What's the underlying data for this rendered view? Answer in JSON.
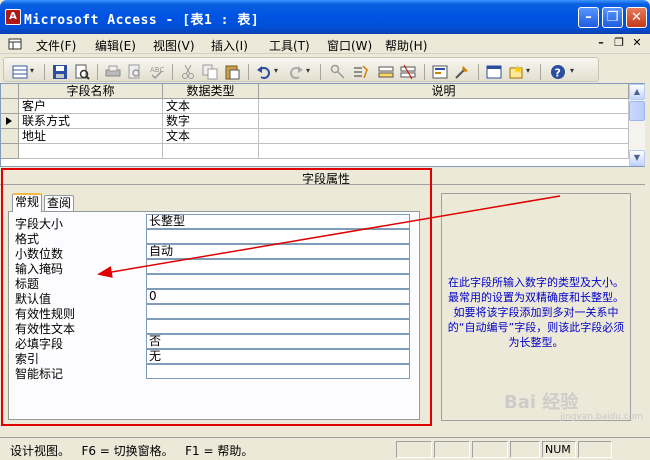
{
  "window": {
    "title": "Microsoft Access - [表1 : 表]",
    "app_icon_letter": "A",
    "buttons": {
      "minimize": "–",
      "restore": "❐",
      "close": "✕"
    }
  },
  "menu": {
    "items": [
      "文件(F)",
      "编辑(E)",
      "视图(V)",
      "插入(I)",
      "工具(T)",
      "窗口(W)",
      "帮助(H)"
    ],
    "mdi_minimize": "–",
    "mdi_restore": "❐",
    "mdi_close": "✕"
  },
  "toolbar": {
    "icons": [
      "design-view-icon",
      "save-icon",
      "search-icon",
      "print-icon",
      "print-preview-icon",
      "spelling-icon",
      "cut-icon",
      "copy-icon",
      "paste-icon",
      "undo-icon",
      "redo-icon",
      "primary-key-icon",
      "indexes-icon",
      "insert-rows-icon",
      "delete-rows-icon",
      "properties-icon",
      "build-icon",
      "database-window-icon",
      "new-object-icon",
      "help-icon"
    ],
    "dropdown_glyph": "▾"
  },
  "field_grid": {
    "columns": [
      "字段名称",
      "数据类型",
      "说明"
    ],
    "rows": [
      {
        "name": "客户",
        "type": "文本",
        "desc": ""
      },
      {
        "name": "联系方式",
        "type": "数字",
        "desc": ""
      },
      {
        "name": "地址",
        "type": "文本",
        "desc": ""
      },
      {
        "name": "",
        "type": "",
        "desc": ""
      }
    ],
    "current_row_index": 1
  },
  "field_properties": {
    "title": "字段属性",
    "tabs": [
      "常规",
      "查阅"
    ],
    "active_tab": "常规",
    "rows": [
      {
        "label": "字段大小",
        "value": "长整型"
      },
      {
        "label": "格式",
        "value": ""
      },
      {
        "label": "小数位数",
        "value": "自动"
      },
      {
        "label": "输入掩码",
        "value": ""
      },
      {
        "label": "标题",
        "value": ""
      },
      {
        "label": "默认值",
        "value": "0"
      },
      {
        "label": "有效性规则",
        "value": ""
      },
      {
        "label": "有效性文本",
        "value": ""
      },
      {
        "label": "必填字段",
        "value": "否"
      },
      {
        "label": "索引",
        "value": "无"
      },
      {
        "label": "智能标记",
        "value": ""
      }
    ],
    "help_text": "在此字段所输入数字的类型及大小。 最常用的设置为双精确度和长整型。 如要将该字段添加到多对一关系中的“自动编号”字段，则该此字段必须为长整型。"
  },
  "watermark": {
    "text": "Bai 经验",
    "sub": "jingyan.baidu.com"
  },
  "status_bar": {
    "text": "设计视图。   F6 = 切换窗格。   F1 = 帮助。",
    "num_indicator": "NUM"
  },
  "colors": {
    "title_bar": "#0054e3",
    "annotation_red": "#e00000",
    "help_text_blue": "#0000c8"
  }
}
